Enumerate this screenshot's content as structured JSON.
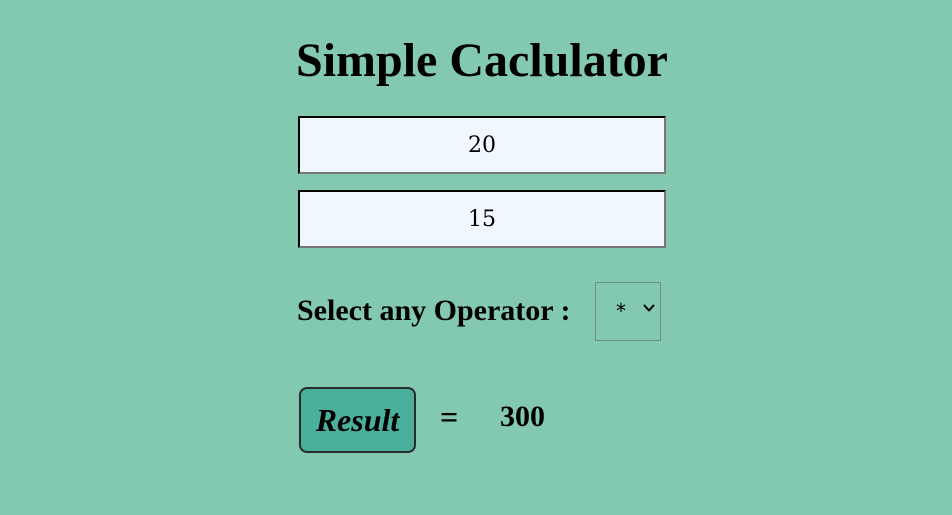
{
  "page": {
    "title": "Simple Caclulator"
  },
  "inputs": {
    "first_value": "20",
    "second_value": "15"
  },
  "operator": {
    "label": "Select any Operator :",
    "selected": "*",
    "chevron_icon": "chevron-down-icon"
  },
  "result": {
    "button_label": "Result",
    "equals_sign": "=",
    "value": "300"
  },
  "colors": {
    "background": "#82c9b0",
    "input_background": "#f0f7ff",
    "button_background": "#4aaf9b"
  }
}
